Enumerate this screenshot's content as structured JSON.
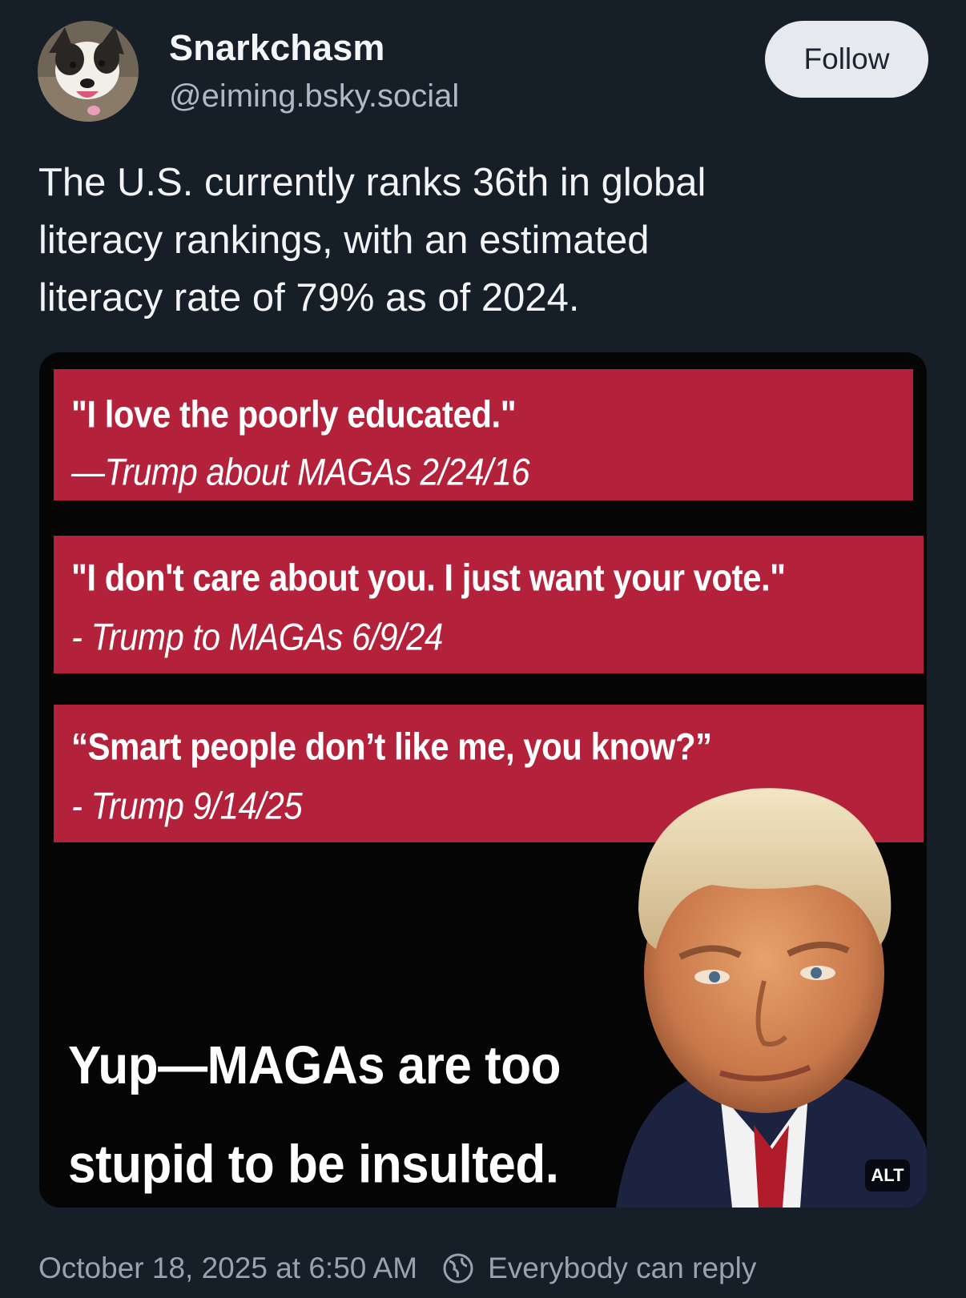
{
  "author": {
    "display_name": "Snarkchasm",
    "handle": "@eiming.bsky.social",
    "follow_label": "Follow"
  },
  "post": {
    "text": "The U.S. currently ranks 36th in global\nliteracy rankings, with an estimated\nliteracy rate of 79% as of 2024.",
    "timestamp": "October 18, 2025 at 6:50 AM",
    "reply_setting": "Everybody can reply"
  },
  "image": {
    "quotes": [
      {
        "text": "\"I love the poorly educated.\"",
        "attribution": "—Trump about MAGAs 2/24/16"
      },
      {
        "text": "\"I don't care about you. I just want your vote.\"",
        "attribution": "- Trump to MAGAs 6/9/24"
      },
      {
        "text": "“Smart people don’t like me, you know?”",
        "attribution": "- Trump 9/14/25"
      }
    ],
    "caption": "Yup—MAGAs are too\nstupid to be insulted.",
    "alt_badge": "ALT",
    "quote_box_color": "#b3213a"
  },
  "icons": {
    "reply_setting": "globe-icon"
  },
  "colors": {
    "background": "#161e27",
    "muted_text": "#98a3b1",
    "follow_button_bg": "#e6e9ee"
  }
}
